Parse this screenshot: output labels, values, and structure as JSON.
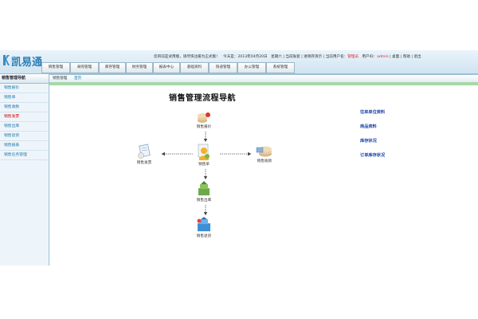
{
  "brand": {
    "name": "凯易通"
  },
  "topbar": {
    "notice": "您目前是试用版，请尽快注册为正式版！",
    "date": "今天是：2013年04月20日",
    "weekday": "星期六",
    "current_account": "当前账套",
    "demo": "进销存演示",
    "current_user_label": "当前用户名：",
    "current_user": "管理员",
    "user_id_label": "用户ID：",
    "user_id": "admin",
    "links": [
      "桌面",
      "帮助",
      "退出"
    ]
  },
  "nav": {
    "tabs": [
      "销售管理",
      "采购管理",
      "库存管理",
      "财务管理",
      "报表中心",
      "基础资料",
      "快递管理",
      "办公管理",
      "系统管理"
    ]
  },
  "sidebar": {
    "title": "销售管理导航",
    "items": [
      {
        "label": "销售报价",
        "active": false
      },
      {
        "label": "销售单",
        "active": false
      },
      {
        "label": "销售收款",
        "active": false
      },
      {
        "label": "销售发票",
        "active": true
      },
      {
        "label": "销售出库",
        "active": false
      },
      {
        "label": "销售退货",
        "active": false
      },
      {
        "label": "销售报表",
        "active": false
      },
      {
        "label": "销售任务管理",
        "active": false
      }
    ]
  },
  "breadcrumb": {
    "section": "销售管理",
    "home": "首页"
  },
  "main": {
    "title": "销售管理流程导航",
    "nodes": {
      "quote": "销售报价",
      "order": "销售单",
      "invoice": "销售发票",
      "receipt": "销售收款",
      "outbound": "销售出库",
      "return": "销售退货"
    },
    "links": [
      "往来单位资料",
      "商品资料",
      "库存状况",
      "订单库存状况"
    ]
  },
  "colors": {
    "accent": "#2f7fb5",
    "link": "#1a45a8",
    "active": "#cc0000",
    "green_bar": "#a6d8a8"
  }
}
